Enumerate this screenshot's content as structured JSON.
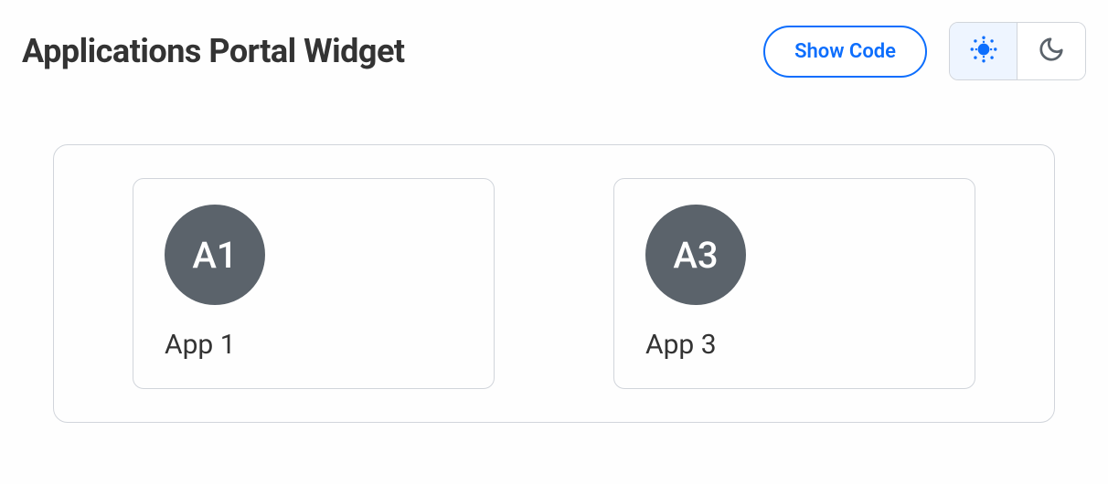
{
  "header": {
    "title": "Applications Portal Widget",
    "show_code_label": "Show Code"
  },
  "theme": {
    "active": "light"
  },
  "apps": [
    {
      "avatar": "A1",
      "label": "App 1"
    },
    {
      "avatar": "A3",
      "label": "App 3"
    }
  ]
}
